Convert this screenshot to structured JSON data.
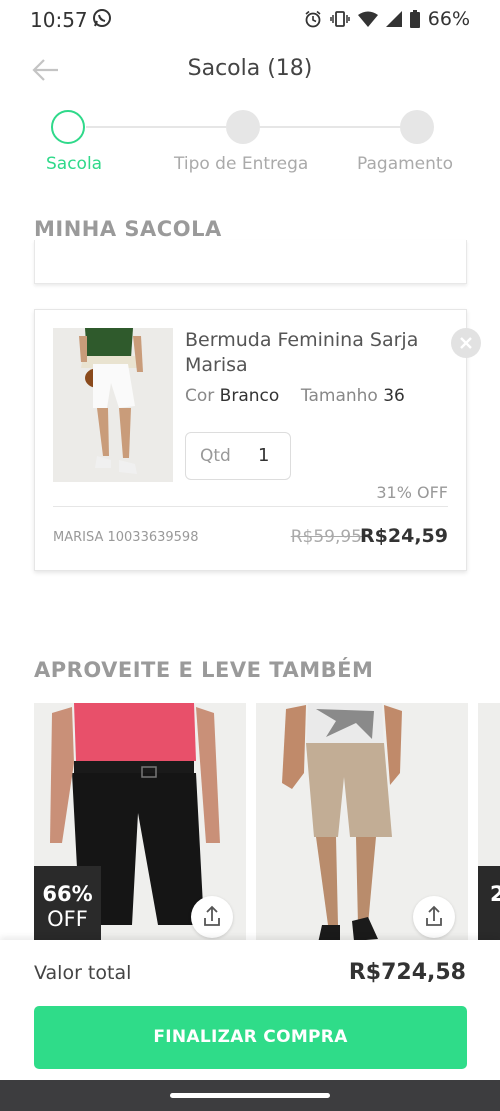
{
  "status_bar": {
    "time": "10:57",
    "battery": "66%"
  },
  "header": {
    "title": "Sacola (18)"
  },
  "stepper": {
    "steps": [
      {
        "label": "Sacola",
        "active": true
      },
      {
        "label": "Tipo de Entrega",
        "active": false
      },
      {
        "label": "Pagamento",
        "active": false
      }
    ]
  },
  "cart": {
    "section_title": "MINHA SACOLA",
    "item": {
      "name": "Bermuda Feminina Sarja Marisa",
      "color_label": "Cor",
      "color_value": "Branco",
      "size_label": "Tamanho",
      "size_value": "36",
      "qty_label": "Qtd",
      "qty_value": "1",
      "discount": "31% OFF",
      "sku": "MARISA 10033639598",
      "old_price": "R$59,95",
      "price": "R$24,59"
    }
  },
  "recommendations": {
    "section_title": "APROVEITE E LEVE TAMBÉM",
    "items": [
      {
        "badge_pct": "66%",
        "badge_off": "OFF"
      },
      {},
      {
        "badge_pct": "2"
      }
    ]
  },
  "footer": {
    "total_label": "Valor total",
    "total_value": "R$724,58",
    "checkout_label": "FINALIZAR COMPRA"
  },
  "colors": {
    "accent": "#2fdc89",
    "badge_bg": "#2a2a2a"
  }
}
